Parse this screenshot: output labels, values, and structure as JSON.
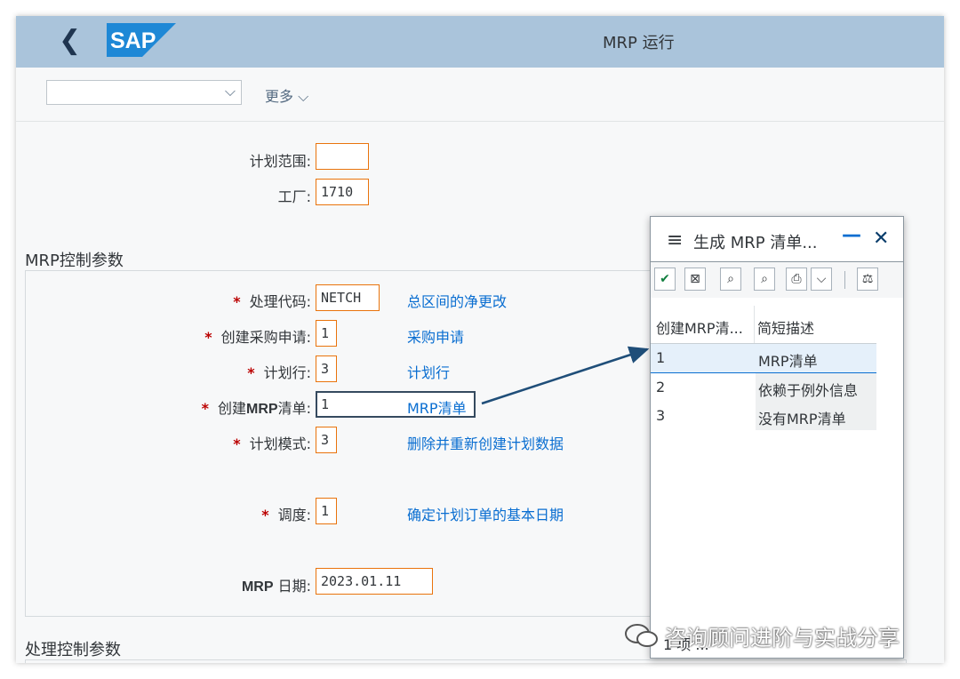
{
  "shell": {
    "title": "MRP 运行",
    "logo_text": "SAP",
    "brand_color": "#aac4db"
  },
  "toolbar": {
    "select_value": "",
    "more_label": "更多"
  },
  "fields": {
    "plan_scope_label": "计划范围:",
    "plan_scope_value": "",
    "plant_label": "工厂:",
    "plant_value": "1710"
  },
  "mrp_section": {
    "title": "MRP控制参数",
    "rows": [
      {
        "label": "处理代码:",
        "value": "NETCH",
        "desc": "总区间的净更改"
      },
      {
        "label": "创建采购申请:",
        "value": "1",
        "desc": "采购申请"
      },
      {
        "label": "计划行:",
        "value": "3",
        "desc": "计划行"
      },
      {
        "label_prefix": "创建",
        "label_bold": "MRP",
        "label_suffix": "清单:",
        "value": "1",
        "desc": "MRP清单"
      },
      {
        "label": "计划模式:",
        "value": "3",
        "desc": "删除并重新创建计划数据"
      },
      {
        "label": "调度:",
        "value": "1",
        "desc": "确定计划订单的基本日期"
      }
    ],
    "date_label_bold": "MRP",
    "date_label": " 日期:",
    "date_value": "2023.01.11"
  },
  "processing_section": {
    "title": "处理控制参数"
  },
  "popup": {
    "title": "生成 MRP 清单...",
    "col1": "创建MRP清...",
    "col1_bold": "MRP",
    "col2": "简短描述",
    "rows": [
      {
        "code": "1",
        "text": "MRP清单"
      },
      {
        "code": "2",
        "text": "依赖于例外信息"
      },
      {
        "code": "3",
        "text": "没有MRP清单"
      }
    ],
    "footer": "1 项 ...",
    "icons": [
      "check-icon",
      "cancel-icon",
      "search-icon",
      "search-plus-icon",
      "print-icon",
      "chevron-down-icon",
      "filter-icon"
    ]
  },
  "watermark": "咨询顾问进阶与实战分享",
  "colors": {
    "required": "#bb0000",
    "link": "#0a6ed1",
    "input_border": "#e9730c",
    "arrow": "#1f4e79"
  }
}
